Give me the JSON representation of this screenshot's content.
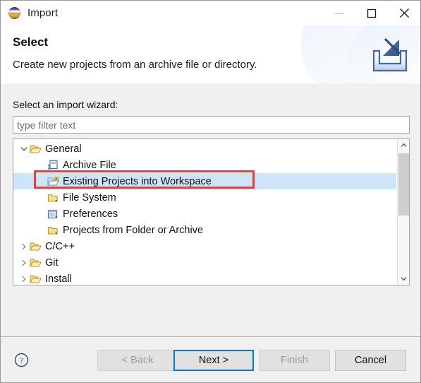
{
  "window": {
    "title": "Import",
    "app_icon": "eclipse-sphere-icon",
    "controls": {
      "minimize": "minimize-icon",
      "maximize": "maximize-icon",
      "close": "close-icon"
    }
  },
  "header": {
    "title": "Select",
    "description": "Create new projects from an archive file or directory.",
    "banner_icon": "import-tray-arrow-icon"
  },
  "main": {
    "field_label": "Select an import wizard:",
    "filter": {
      "value": "",
      "placeholder": "type filter text"
    },
    "tree": [
      {
        "label": "General",
        "icon": "open-folder-icon",
        "level": 0,
        "twisty": "expanded",
        "selected": false
      },
      {
        "label": "Archive File",
        "icon": "archive-file-icon",
        "level": 1,
        "twisty": "none",
        "selected": false
      },
      {
        "label": "Existing Projects into Workspace",
        "icon": "import-folder-icon",
        "level": 1,
        "twisty": "none",
        "selected": true
      },
      {
        "label": "File System",
        "icon": "folder-icon",
        "level": 1,
        "twisty": "none",
        "selected": false
      },
      {
        "label": "Preferences",
        "icon": "preferences-grid-icon",
        "level": 1,
        "twisty": "none",
        "selected": false
      },
      {
        "label": "Projects from Folder or Archive",
        "icon": "folder-icon",
        "level": 1,
        "twisty": "none",
        "selected": false
      },
      {
        "label": "C/C++",
        "icon": "open-folder-icon",
        "level": 0,
        "twisty": "collapsed",
        "selected": false
      },
      {
        "label": "Git",
        "icon": "open-folder-icon",
        "level": 0,
        "twisty": "collapsed",
        "selected": false
      },
      {
        "label": "Install",
        "icon": "open-folder-icon",
        "level": 0,
        "twisty": "collapsed",
        "selected": false
      }
    ],
    "scrollbar": {
      "up": "chevron-up-icon",
      "down": "chevron-down-icon"
    },
    "annotation": {
      "type": "rectangle-highlight",
      "target": "Existing Projects into Workspace",
      "color": "#f23c37"
    }
  },
  "footer": {
    "help_icon": "help-question-icon",
    "buttons": [
      {
        "label": "< Back",
        "state": "disabled"
      },
      {
        "label": "Next >",
        "state": "focused"
      },
      {
        "label": "Finish",
        "state": "disabled"
      },
      {
        "label": "Cancel",
        "state": "enabled"
      }
    ]
  },
  "colors": {
    "selection": "#cde5f7",
    "focus_border": "#0078d7",
    "annotation": "#f23c37",
    "dialog_bg": "#f0f0f0"
  }
}
